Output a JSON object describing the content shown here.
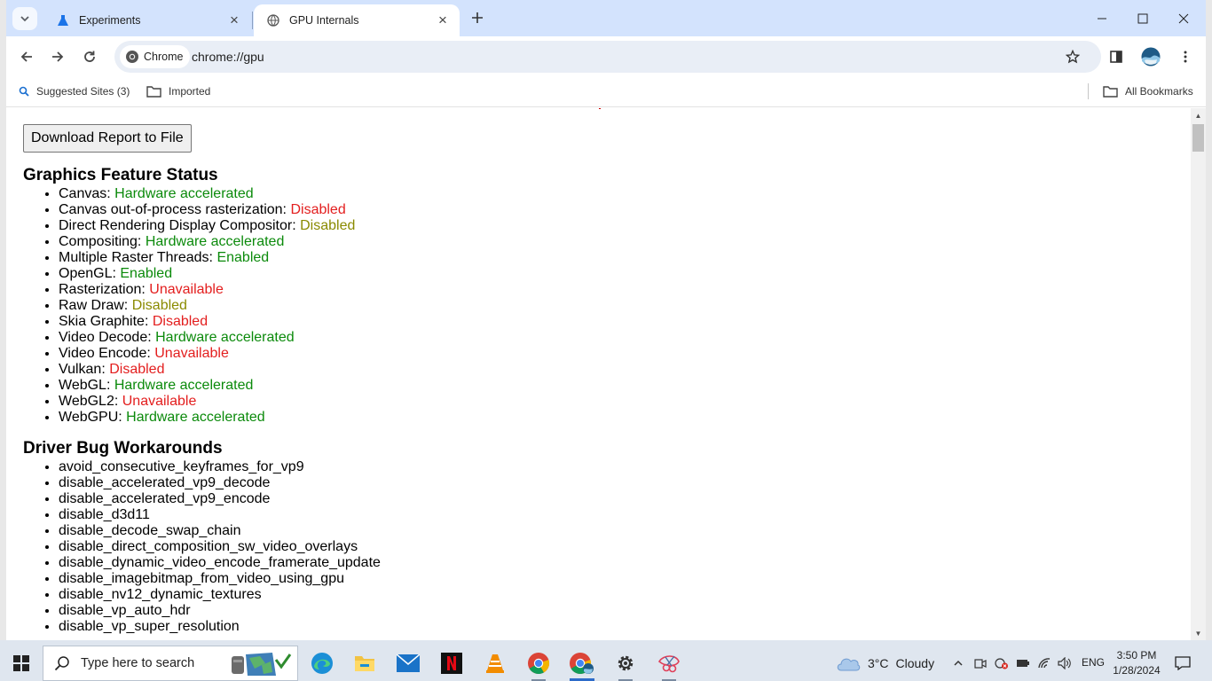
{
  "tabs": [
    {
      "title": "Experiments",
      "icon": "flask-icon"
    },
    {
      "title": "GPU Internals",
      "icon": "globe-icon"
    }
  ],
  "omnibox": {
    "chip_label": "Chrome",
    "url": "chrome://gpu"
  },
  "bookmarks": {
    "suggested": "Suggested Sites (3)",
    "imported": "Imported",
    "all": "All Bookmarks"
  },
  "page": {
    "download_button": "Download Report to File",
    "features": {
      "title": "Graphics Feature Status",
      "items": [
        {
          "name": "Canvas: ",
          "status": "Hardware accelerated",
          "color": "#0b8a0b"
        },
        {
          "name": "Canvas out-of-process rasterization: ",
          "status": "Disabled",
          "color": "#e31e1e"
        },
        {
          "name": "Direct Rendering Display Compositor: ",
          "status": "Disabled",
          "color": "#8a8a00"
        },
        {
          "name": "Compositing: ",
          "status": "Hardware accelerated",
          "color": "#0b8a0b"
        },
        {
          "name": "Multiple Raster Threads: ",
          "status": "Enabled",
          "color": "#0b8a0b"
        },
        {
          "name": "OpenGL: ",
          "status": "Enabled",
          "color": "#0b8a0b"
        },
        {
          "name": "Rasterization: ",
          "status": "Unavailable",
          "color": "#e31e1e"
        },
        {
          "name": "Raw Draw: ",
          "status": "Disabled",
          "color": "#8a8a00"
        },
        {
          "name": "Skia Graphite: ",
          "status": "Disabled",
          "color": "#e31e1e"
        },
        {
          "name": "Video Decode: ",
          "status": "Hardware accelerated",
          "color": "#0b8a0b"
        },
        {
          "name": "Video Encode: ",
          "status": "Unavailable",
          "color": "#e31e1e"
        },
        {
          "name": "Vulkan: ",
          "status": "Disabled",
          "color": "#e31e1e"
        },
        {
          "name": "WebGL: ",
          "status": "Hardware accelerated",
          "color": "#0b8a0b"
        },
        {
          "name": "WebGL2: ",
          "status": "Unavailable",
          "color": "#e31e1e"
        },
        {
          "name": "WebGPU: ",
          "status": "Hardware accelerated",
          "color": "#0b8a0b"
        }
      ]
    },
    "workarounds": {
      "title": "Driver Bug Workarounds",
      "items": [
        "avoid_consecutive_keyframes_for_vp9",
        "disable_accelerated_vp9_decode",
        "disable_accelerated_vp9_encode",
        "disable_d3d11",
        "disable_decode_swap_chain",
        "disable_direct_composition_sw_video_overlays",
        "disable_dynamic_video_encode_framerate_update",
        "disable_imagebitmap_from_video_using_gpu",
        "disable_nv12_dynamic_textures",
        "disable_vp_auto_hdr",
        "disable_vp_super_resolution"
      ]
    }
  },
  "taskbar": {
    "search_placeholder": "Type here to search",
    "weather_temp": "3°C",
    "weather_cond": "Cloudy",
    "lang": "ENG",
    "time": "3:50 PM",
    "date": "1/28/2024"
  }
}
